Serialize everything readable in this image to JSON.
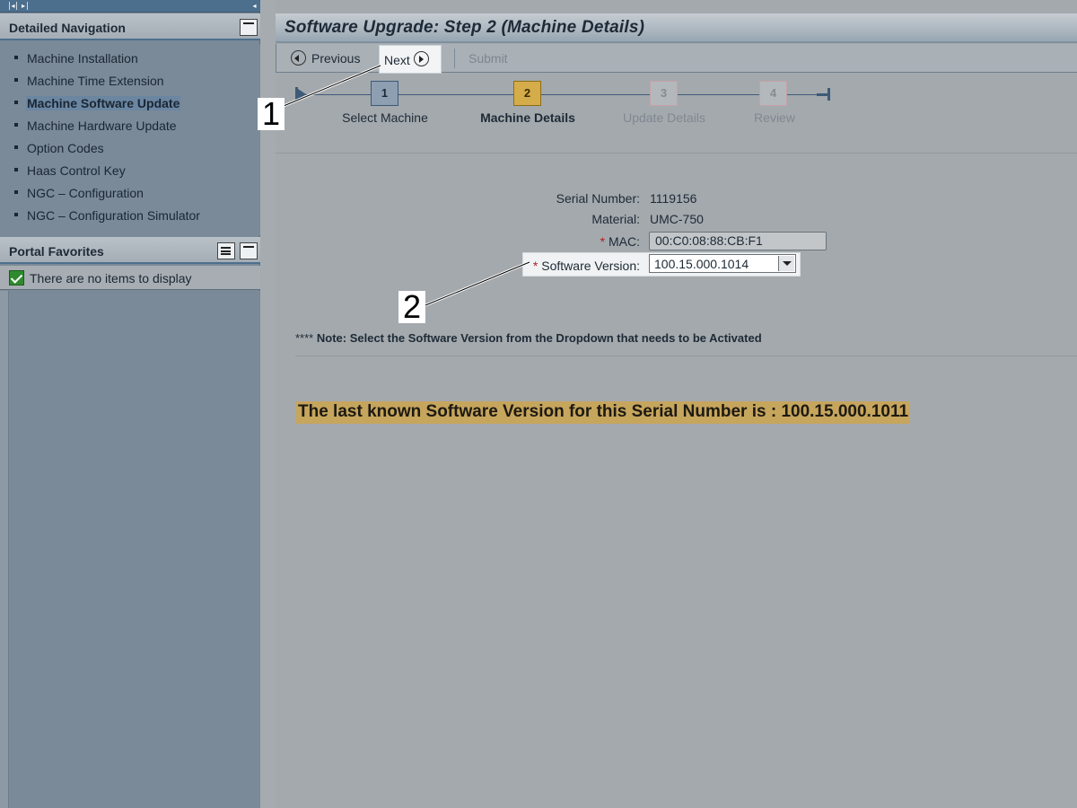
{
  "sidebar": {
    "detailed_navigation": {
      "title": "Detailed Navigation",
      "items": [
        {
          "label": "Machine Installation"
        },
        {
          "label": "Machine Time Extension"
        },
        {
          "label": "Machine Software Update",
          "active": true
        },
        {
          "label": "Machine Hardware Update"
        },
        {
          "label": "Option Codes"
        },
        {
          "label": "Haas Control Key"
        },
        {
          "label": "NGC – Configuration"
        },
        {
          "label": "NGC – Configuration Simulator"
        }
      ]
    },
    "portal_favorites": {
      "title": "Portal Favorites",
      "empty_text": "There are no items to display"
    }
  },
  "main": {
    "title": "Software Upgrade: Step 2  (Machine Details)",
    "toolbar": {
      "previous_label": "Previous",
      "next_label": "Next",
      "submit_label": "Submit"
    },
    "roadmap": {
      "steps": [
        {
          "number": "1",
          "label": "Select Machine",
          "state": "completed"
        },
        {
          "number": "2",
          "label": "Machine Details",
          "state": "current"
        },
        {
          "number": "3",
          "label": "Update Details",
          "state": "disabled"
        },
        {
          "number": "4",
          "label": "Review",
          "state": "disabled"
        }
      ]
    },
    "form": {
      "serial_label": "Serial Number:",
      "serial_value": "1119156",
      "material_label": "Material:",
      "material_value": "UMC-750",
      "mac_required": "*",
      "mac_label": "MAC:",
      "mac_value": "00:C0:08:88:CB:F1",
      "software_required": "*",
      "software_label": "Software Version:",
      "software_value": "100.15.000.1014"
    },
    "note": {
      "stars": "****",
      "text": "Note: Select the Software Version from the Dropdown that needs to be Activated"
    },
    "last_known": "The last known Software Version for this Serial Number is : 100.15.000.1011"
  },
  "annotations": {
    "callout_1": "1",
    "callout_2": "2"
  },
  "colors": {
    "nav_header_border": "#4d6f8e",
    "current_step": "#d4ad4a",
    "last_known_highlight": "#c6a55d",
    "required_marker": "#b02020"
  }
}
